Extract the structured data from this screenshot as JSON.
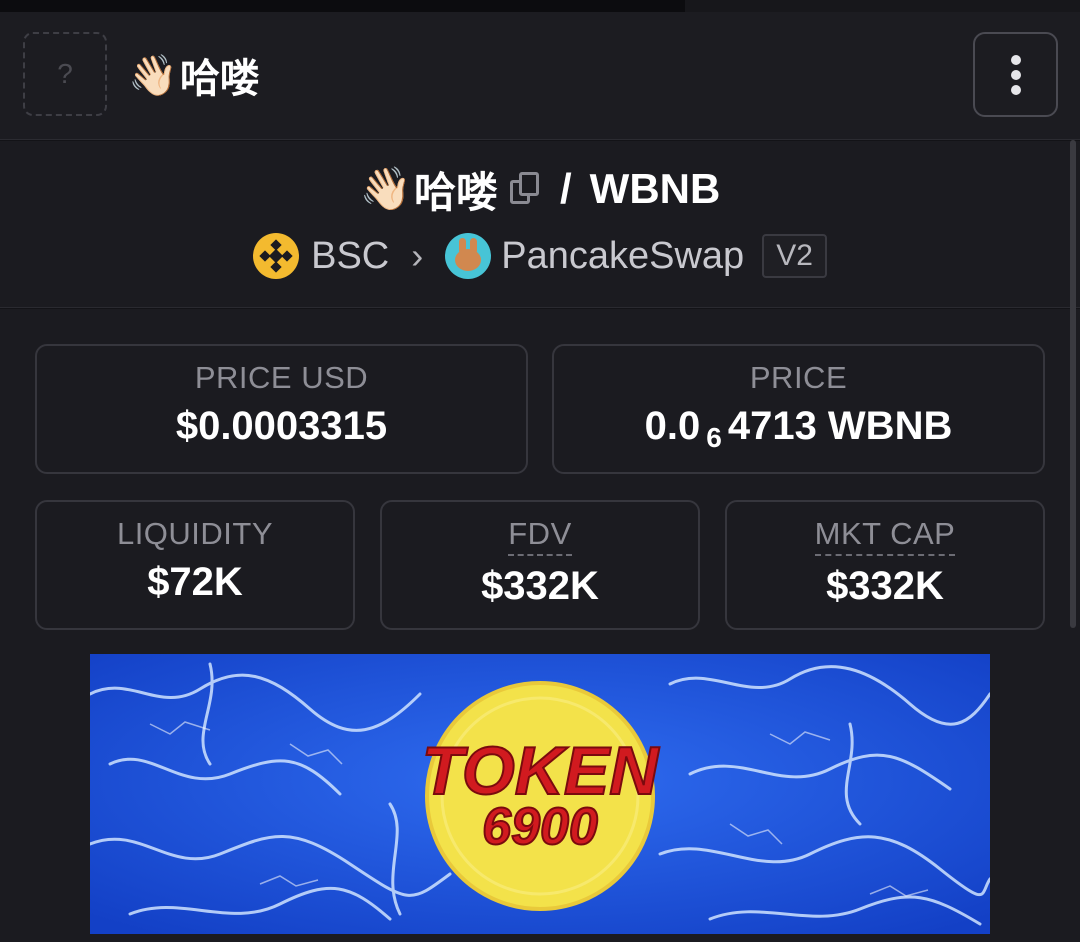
{
  "header": {
    "avatar_placeholder": "?",
    "title_emoji": "👋🏻",
    "title": "哈喽"
  },
  "pair": {
    "base_emoji": "👋🏻",
    "base": "哈喽",
    "separator": "/",
    "quote": "WBNB"
  },
  "chain": {
    "name": "BSC",
    "dex": "PancakeSwap",
    "version": "V2"
  },
  "stats": {
    "price_usd_label": "PRICE USD",
    "price_usd": "$0.0003315",
    "price_label": "PRICE",
    "price_prefix": "0.0",
    "price_zeros": "6",
    "price_suffix": "4713 WBNB",
    "liquidity_label": "LIQUIDITY",
    "liquidity": "$72K",
    "fdv_label": "FDV",
    "fdv": "$332K",
    "mktcap_label": "MKT CAP",
    "mktcap": "$332K"
  },
  "banner": {
    "line1": "TOKEN",
    "line2": "6900",
    "colors": {
      "water": "#1b4fd8",
      "coin": "#f3e24a",
      "text": "#d11a1f"
    }
  }
}
